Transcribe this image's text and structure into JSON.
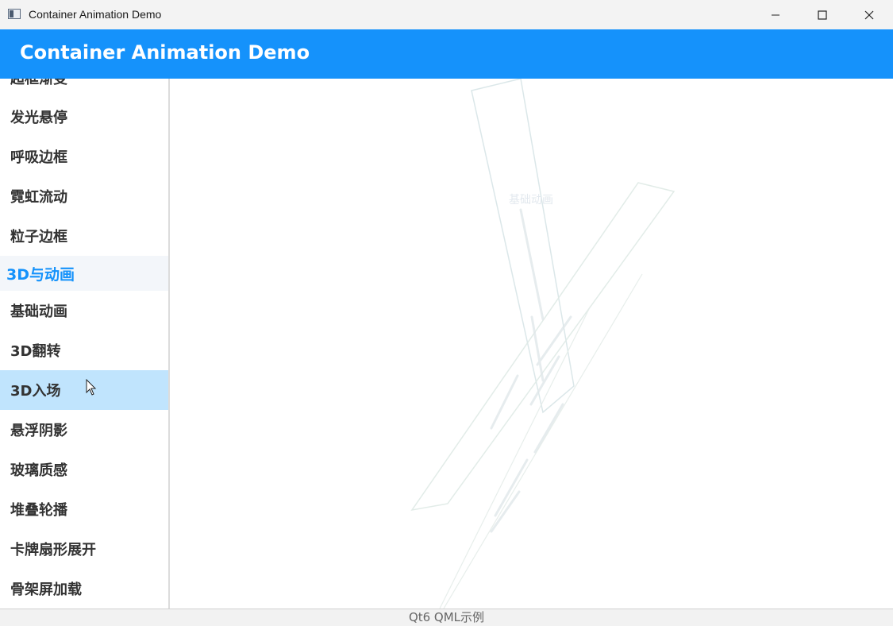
{
  "window": {
    "title": "Container Animation Demo"
  },
  "header": {
    "title": "Container Animation Demo"
  },
  "sidebar": {
    "items": [
      {
        "label": "超框渐变",
        "type": "item"
      },
      {
        "label": "发光悬停",
        "type": "item"
      },
      {
        "label": "呼吸边框",
        "type": "item"
      },
      {
        "label": "霓虹流动",
        "type": "item"
      },
      {
        "label": "粒子边框",
        "type": "item"
      },
      {
        "label": "3D与动画",
        "type": "category"
      },
      {
        "label": "基础动画",
        "type": "item"
      },
      {
        "label": "3D翻转",
        "type": "item"
      },
      {
        "label": "3D入场",
        "type": "item",
        "selected": true
      },
      {
        "label": "悬浮阴影",
        "type": "item"
      },
      {
        "label": "玻璃质感",
        "type": "item"
      },
      {
        "label": "堆叠轮播",
        "type": "item"
      },
      {
        "label": "卡牌扇形展开",
        "type": "item"
      },
      {
        "label": "骨架屏加载",
        "type": "item"
      }
    ]
  },
  "stage": {
    "card_label": "基础动画"
  },
  "footer": {
    "text": "Qt6 QML示例"
  },
  "colors": {
    "accent": "#1592fb",
    "selected": "#c0e4fd",
    "category_bg": "#f3f6fa"
  }
}
